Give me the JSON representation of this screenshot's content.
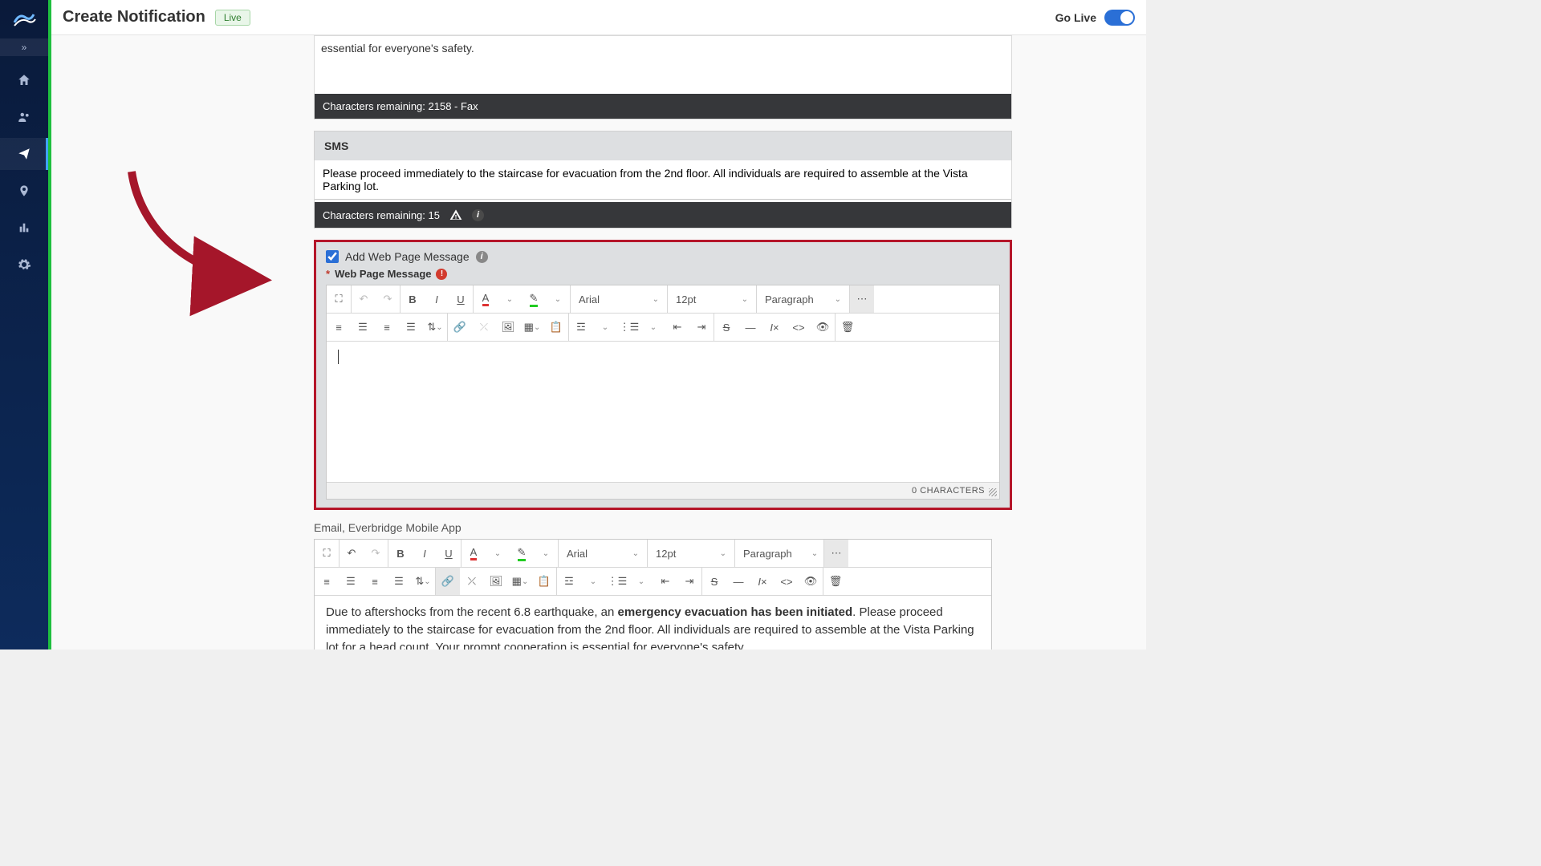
{
  "header": {
    "title": "Create Notification",
    "badge": "Live",
    "go_live": "Go Live"
  },
  "fax": {
    "body_tail": "essential for everyone's safety.",
    "footer": "Characters remaining: 2158 - Fax"
  },
  "sms": {
    "heading": "SMS",
    "value": "Please proceed immediately to the staircase for evacuation from the 2nd floor. All individuals are required to assemble at the Vista Parking lot.",
    "footer": "Characters remaining: 15"
  },
  "webpage": {
    "checkbox_label": "Add Web Page Message",
    "required_label": "Web Page Message",
    "char_counter": "0 CHARACTERS"
  },
  "toolbar": {
    "font": "Arial",
    "size": "12pt",
    "format": "Paragraph"
  },
  "email": {
    "label": "Email, Everbridge Mobile App",
    "body_pre": "Due to aftershocks from the recent 6.8 earthquake, an ",
    "body_bold": "emergency evacuation has been initiated",
    "body_post": ". Please proceed immediately to the staircase for evacuation from the 2nd floor. All individuals are required to assemble at the Vista Parking lot for a head count. Your prompt cooperation is essential for everyone's safety."
  }
}
